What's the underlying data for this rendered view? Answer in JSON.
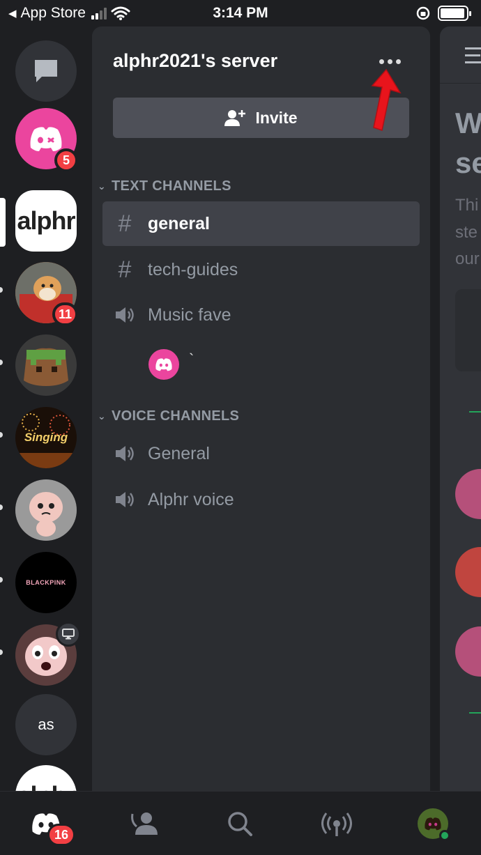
{
  "status_bar": {
    "back_label": "App Store",
    "time": "3:14 PM"
  },
  "servers": [
    {
      "name": "direct-messages",
      "type": "icon"
    },
    {
      "name": "discord-pink",
      "badge": "5"
    },
    {
      "name": "alphr",
      "label": "alphr",
      "selected": true
    },
    {
      "name": "shiba",
      "badge": "11",
      "unread": true
    },
    {
      "name": "minecraft",
      "unread": true
    },
    {
      "name": "singing",
      "label": "Singing",
      "unread": true
    },
    {
      "name": "isaac",
      "unread": true
    },
    {
      "name": "blackpink",
      "label": "BLACKPINK",
      "unread": true
    },
    {
      "name": "crying-isaac",
      "unread": true
    },
    {
      "name": "as",
      "label": "as"
    },
    {
      "name": "alphr-2",
      "label": "alphr"
    }
  ],
  "panel": {
    "server_name": "alphr2021's server",
    "invite_label": "Invite",
    "text_category": "TEXT CHANNELS",
    "voice_category": "VOICE CHANNELS",
    "text_channels": [
      {
        "name": "general",
        "icon": "hash",
        "active": true
      },
      {
        "name": "tech-guides",
        "icon": "hash"
      },
      {
        "name": "Music fave",
        "icon": "speaker"
      }
    ],
    "member_name": "`",
    "voice_channels": [
      {
        "name": "General",
        "icon": "speaker"
      },
      {
        "name": "Alphr voice",
        "icon": "speaker"
      }
    ]
  },
  "peek": {
    "heading": "W\nse",
    "lines": [
      "Thi",
      "ste",
      "our"
    ]
  },
  "bottom_nav": {
    "home_badge": "16"
  },
  "colors": {
    "background": "#1e1f22",
    "panel": "#2b2d31",
    "active_channel": "#404249",
    "invite_button": "#4e5058",
    "badge": "#f23f43",
    "discord_pink": "#eb459e",
    "arrow": "#e8141c"
  }
}
